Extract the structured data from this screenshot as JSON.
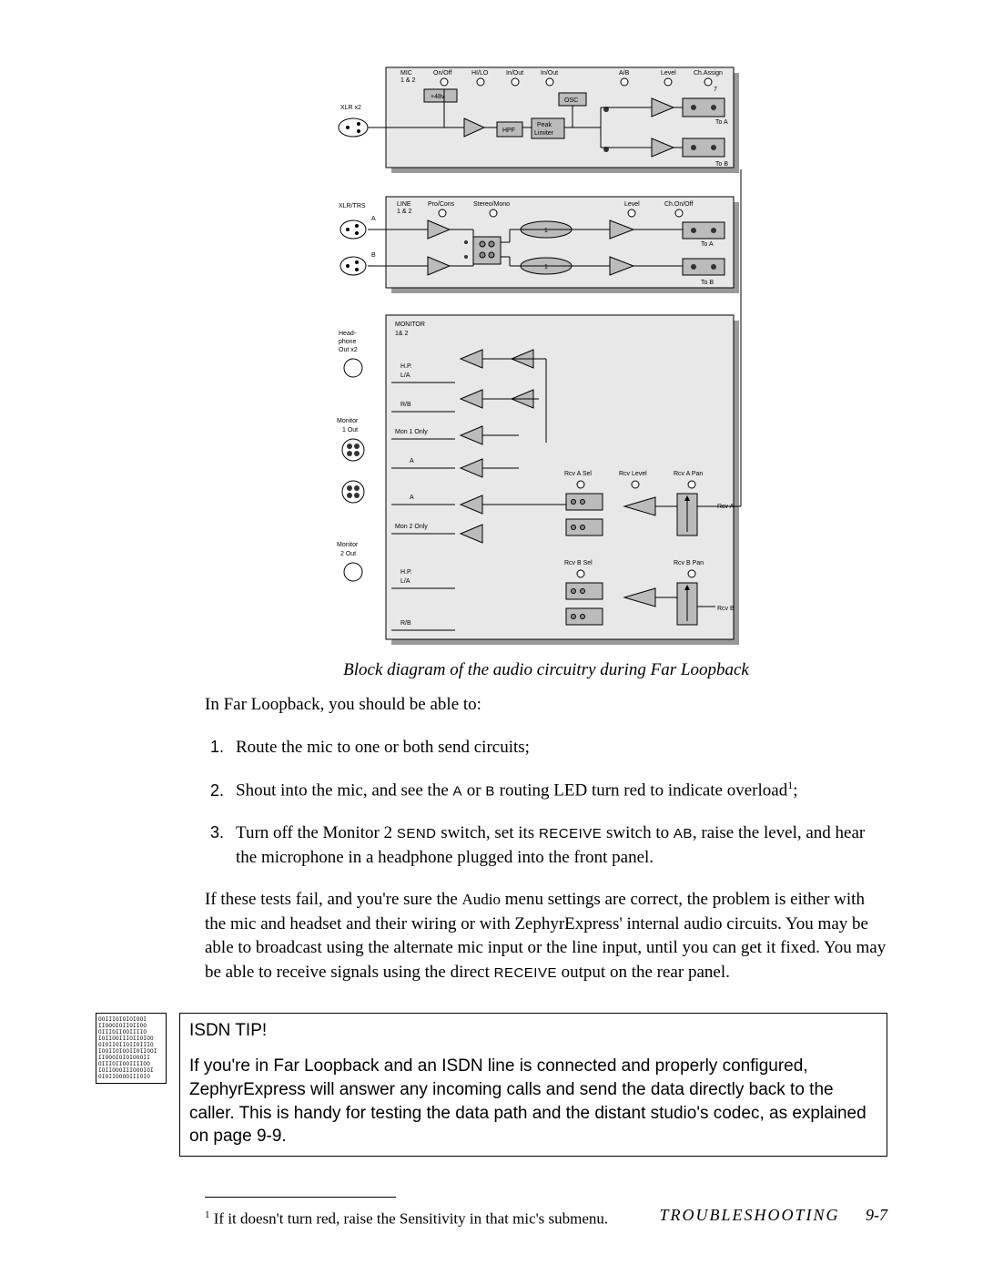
{
  "diagram": {
    "caption": "Block diagram of the audio circuitry during Far Loopback",
    "blocks": {
      "mic": {
        "inputs_label": "XLR x2",
        "labels": {
          "mic12": "MIC\n1 & 2",
          "onoff": "On/Off",
          "hilo": "HI/LO",
          "inout1": "In/Out",
          "inout2": "In/Out",
          "ab": "A/B",
          "level": "Level",
          "chassign": "Ch.Assign",
          "phantom": "+48v",
          "osc": "OSC",
          "hpf": "HPF",
          "peak": "Peak\nLimiter",
          "toA": "To A",
          "toB": "To B",
          "seven": "7"
        }
      },
      "line": {
        "input_label": "XLR/TRS",
        "a": "A",
        "b": "B",
        "labels": {
          "line12": "LINE\n1 & 2",
          "procons": "Pro/Cons",
          "stmono": "Stereo/Mono",
          "level": "Level",
          "chonoff": "Ch.On/Off",
          "toA": "To A",
          "toB": "To B",
          "plus": "+",
          "bubble1": "1",
          "bubble2": "1"
        }
      },
      "monitor": {
        "hp_label": "Head-\nphone\nOut x2",
        "mon1_label": "Monitor\n1 Out",
        "mon2_label": "Monitor\n2 Out",
        "labels": {
          "monitor12": "MONITOR\n1& 2",
          "hp_la": "H.P.\nL/A",
          "rb": "R/B",
          "mon1only": "Mon 1 Only",
          "mon2only": "Mon 2 Only",
          "a": "A",
          "rcv_a_sel": "Rcv A Sel",
          "rcv_level": "Rcv Level",
          "rcv_a_pan": "Rcv A Pan",
          "rcv_a": "Rcv A",
          "rcv_b_sel": "Rcv B Sel",
          "rcv_b_pan": "Rcv B Pan",
          "rcv_b": "Rcv B"
        }
      }
    }
  },
  "intro_para": "In Far Loopback, you should be able to:",
  "steps": [
    {
      "pre": "Route the mic to one or both send circuits;"
    },
    {
      "pre": "Shout into the mic, and see the ",
      "sc1": "A",
      "mid1": " or ",
      "sc2": "B",
      "mid2": " routing LED turn red to indicate overload",
      "sup": "1",
      "post": ";"
    },
    {
      "pre": "Turn off the Monitor 2 ",
      "sc1": "SEND",
      "mid1": " switch, set its ",
      "sc2": "RECEIVE ",
      "mid2": " switch to ",
      "sc3": "AB",
      "mid3": ", raise the level, and hear the microphone in a headphone plugged into the front panel."
    }
  ],
  "para2": {
    "pre": "If these tests fail, and you're sure the ",
    "hand": "Audio",
    "mid": " menu settings are correct, the problem is either with the mic and headset and their wiring or with ZephyrExpress' internal audio circuits. You may be able to broadcast using the alternate mic input or the line input, until you can get it fixed. You may be able to receive signals using the direct ",
    "sc": "RECEIVE ",
    "post": " output on the rear panel."
  },
  "tip": {
    "icon_text": "OOIIIOIOIOIOOI\nIIOOOIOIIOIIOO\nOIIIOIIOOIIIIO\nIOIIOOIIIOIIOIOO\nOIOIIOIIOIIOIIIO\nIOOIIOIOOIIOIIOOI\nIIOOOIOIOIOOOII\nOIIIOIIOOIIIIOO\nIOIIOOOIIIOOOIOI\nOIOIIOOOOIIIOIO",
    "title": "ISDN TIP!",
    "body": "If you're in Far Loopback and an ISDN line is connected and properly configured, ZephyrExpress will answer any incoming calls and send the data directly back to the caller. This is handy for testing the data path and the distant studio's codec, as explained on page  9-9."
  },
  "footnote": {
    "marker": "1",
    "pre": " If it doesn't turn red, raise the ",
    "hand": "Sensitivity",
    "post": " in that mic's submenu."
  },
  "footer": {
    "section": "TROUBLESHOOTING",
    "page": "9-7"
  }
}
